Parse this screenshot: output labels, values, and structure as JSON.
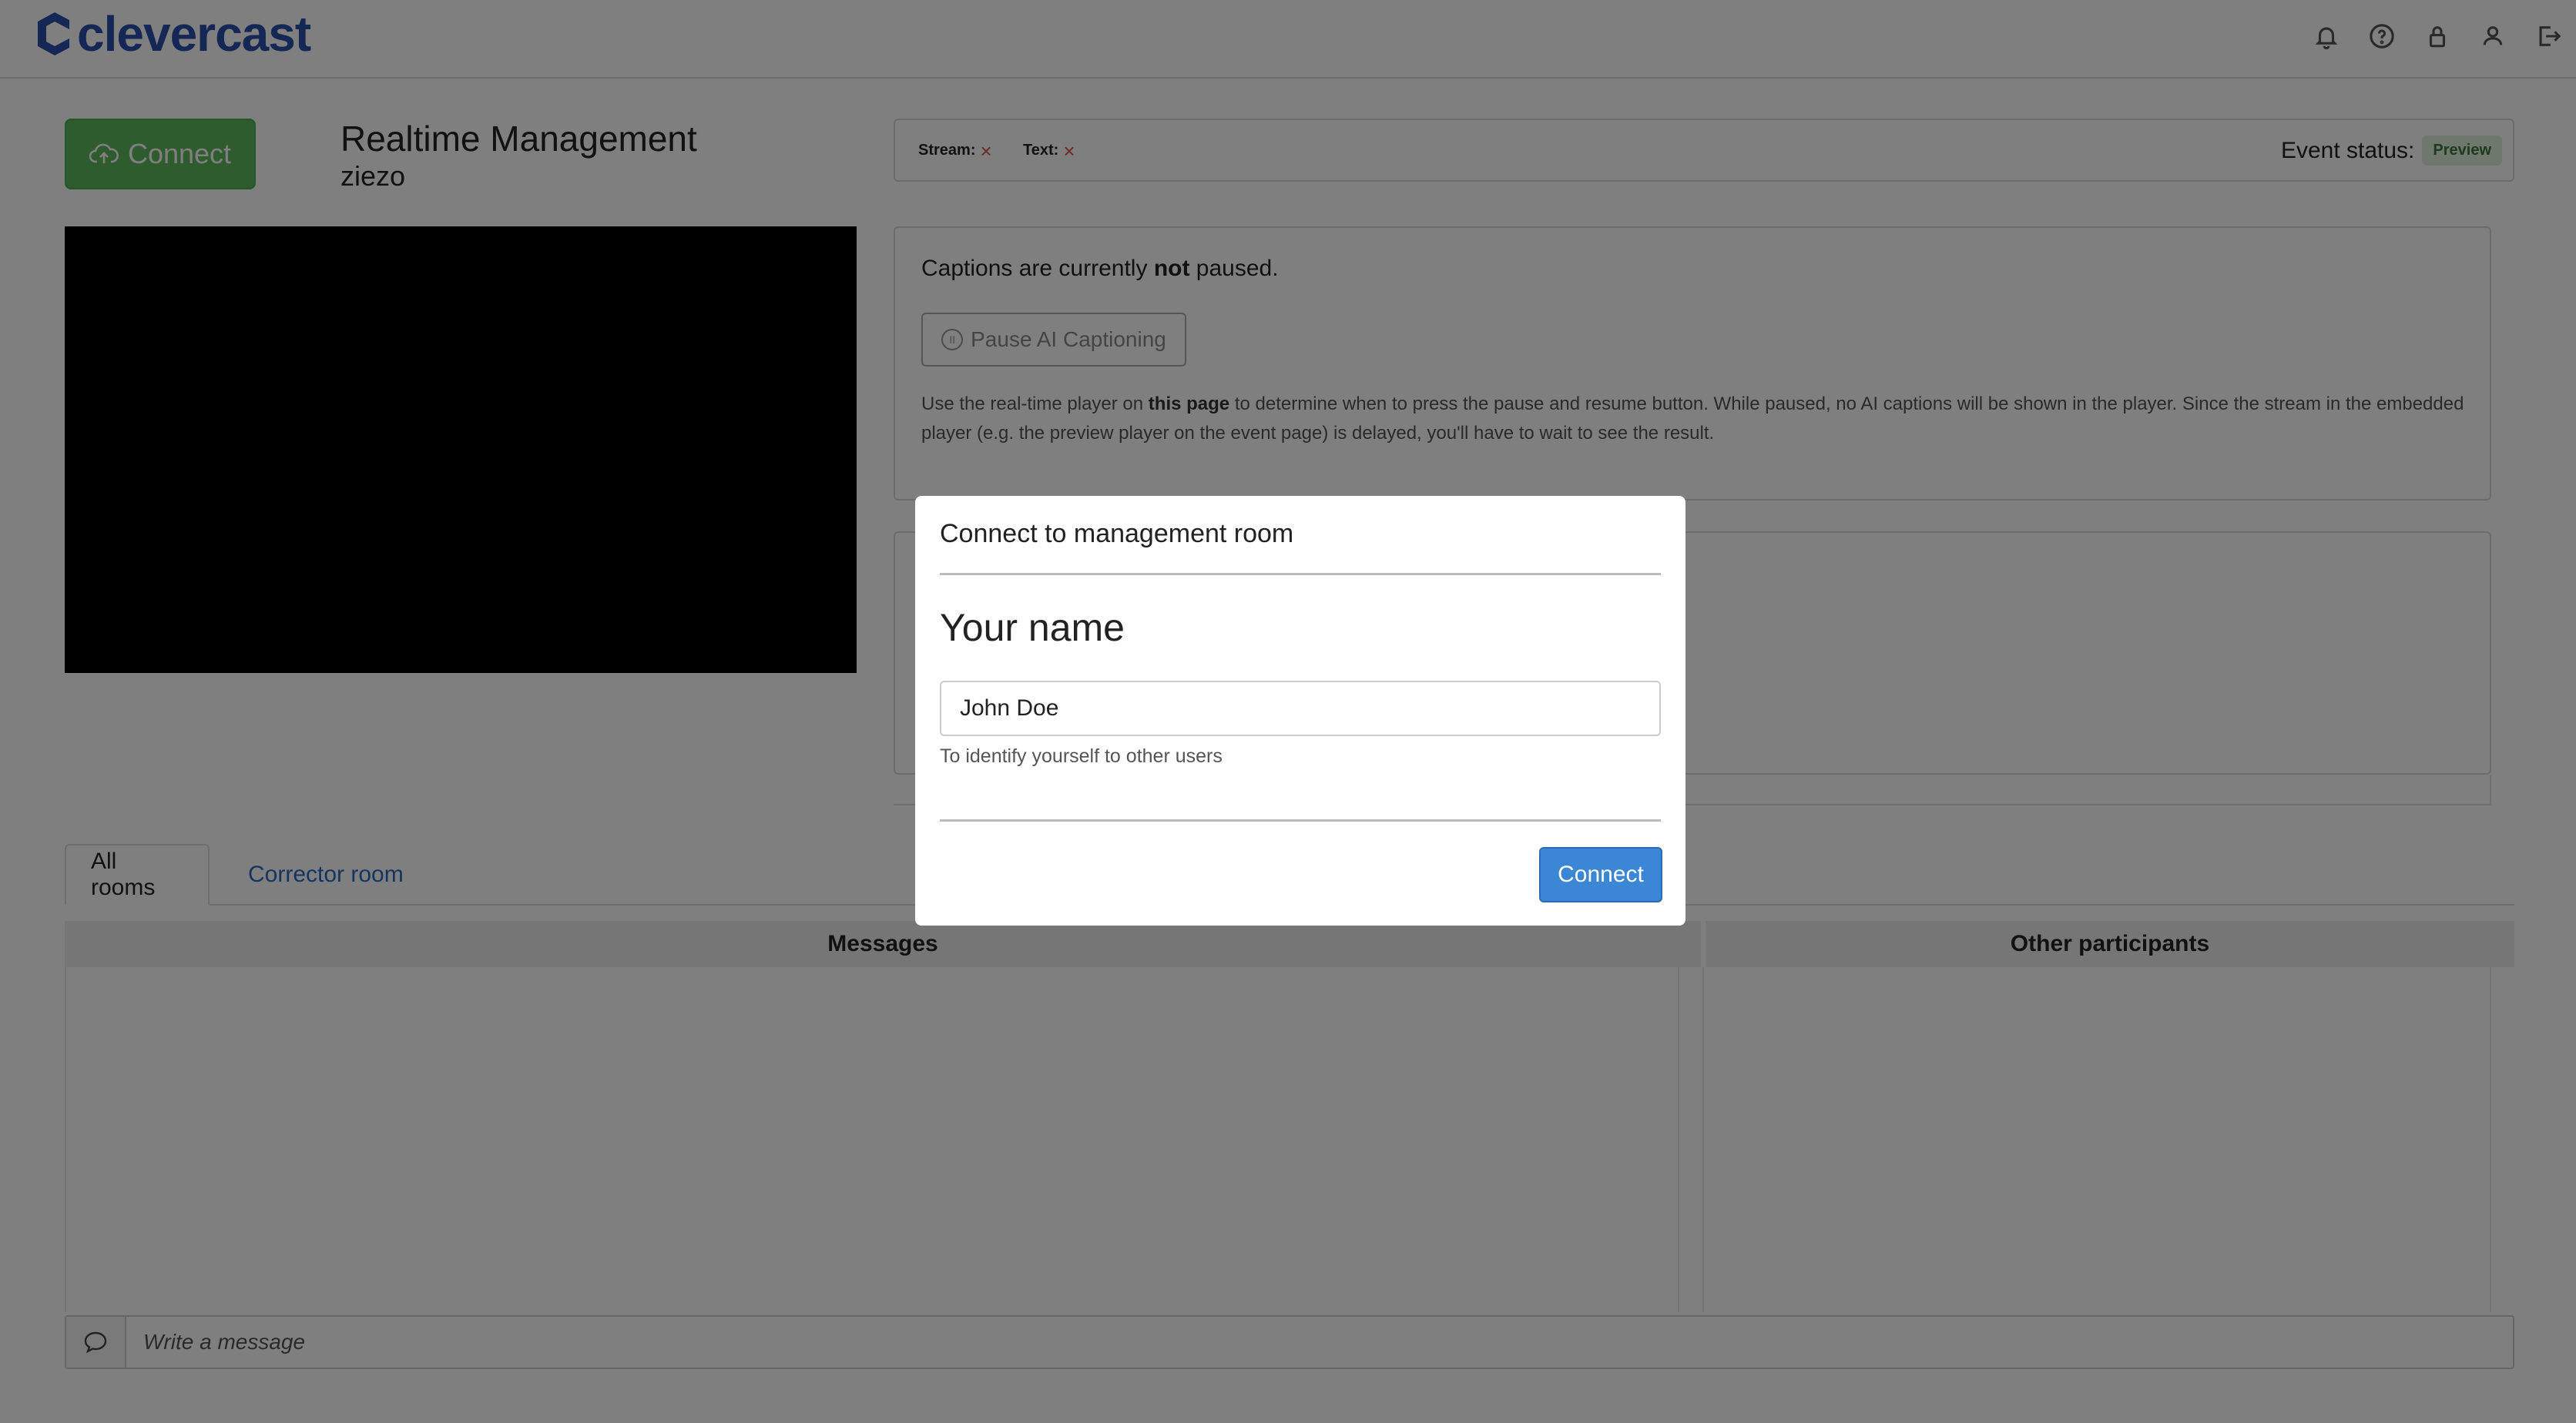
{
  "brand": {
    "name": "clevercast",
    "color": "#2a4fa8"
  },
  "header": {
    "icons": [
      "bell-icon",
      "help-icon",
      "lock-icon",
      "user-icon",
      "logout-icon"
    ]
  },
  "toolbar": {
    "connect_label": "Connect"
  },
  "page": {
    "title": "Realtime Management",
    "subtitle": "ziezo"
  },
  "status": {
    "stream_label": "Stream:",
    "text_label": "Text:",
    "event_status_label": "Event status:",
    "event_status_value": "Preview"
  },
  "captions": {
    "status_prefix": "Captions are currently ",
    "status_bold": "not",
    "status_suffix": " paused.",
    "pause_button": "Pause AI Captioning",
    "help_1": "Use the real-time player on ",
    "help_bold": "this page",
    "help_2": " to determine when to press the pause and resume button. While paused, no AI captions will be shown in the player. Since the stream in the embedded player (e.g. the preview player on the event page) is delayed, you'll have to wait to see the result."
  },
  "tabs": [
    {
      "label": "All rooms",
      "active": true
    },
    {
      "label": "Corrector room",
      "active": false
    }
  ],
  "chat": {
    "messages_header": "Messages",
    "participants_header": "Other participants",
    "message_placeholder": "Write a message"
  },
  "modal": {
    "title": "Connect to management room",
    "label": "Your name",
    "name_value": "John Doe",
    "help": "To identify yourself to other users",
    "connect_button": "Connect"
  }
}
